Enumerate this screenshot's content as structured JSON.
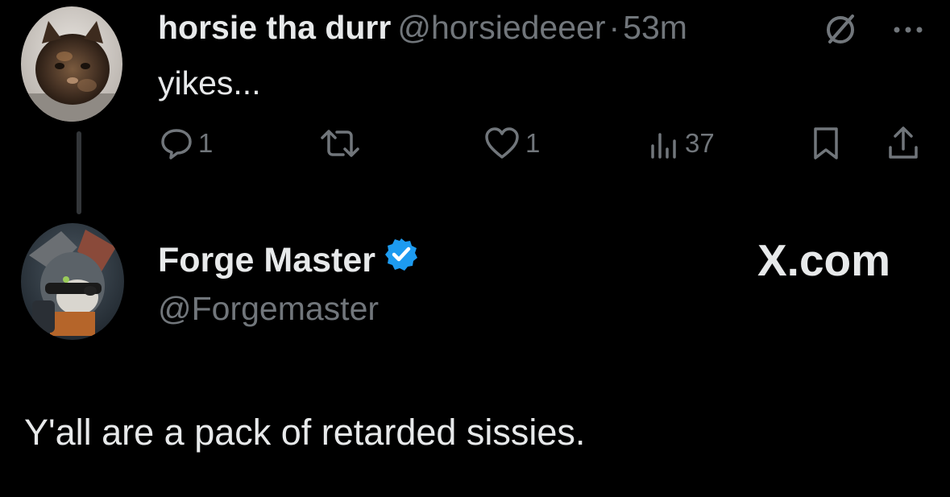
{
  "tweet": {
    "author": {
      "display_name": "horsie tha durr",
      "handle": "@horsiedeeer",
      "separator": "·",
      "time": "53m",
      "avatar_icon": "kitten-avatar"
    },
    "text": "yikes...",
    "menu_icons": [
      "grok-icon",
      "more-options-icon"
    ],
    "actions": {
      "reply_count": "1",
      "retweet_count": "",
      "like_count": "1",
      "views_count": "37"
    }
  },
  "quoted_card": {
    "display_name": "Forge Master",
    "handle": "@Forgemaster",
    "verified": true,
    "brand": "X.com",
    "body": "Y'all are a pack of retarded sissies.",
    "verified_color": "#1d9bf0"
  },
  "colors": {
    "background": "#000000",
    "text": "#e7e9ea",
    "muted": "#71767b",
    "thread_line": "#333639"
  }
}
